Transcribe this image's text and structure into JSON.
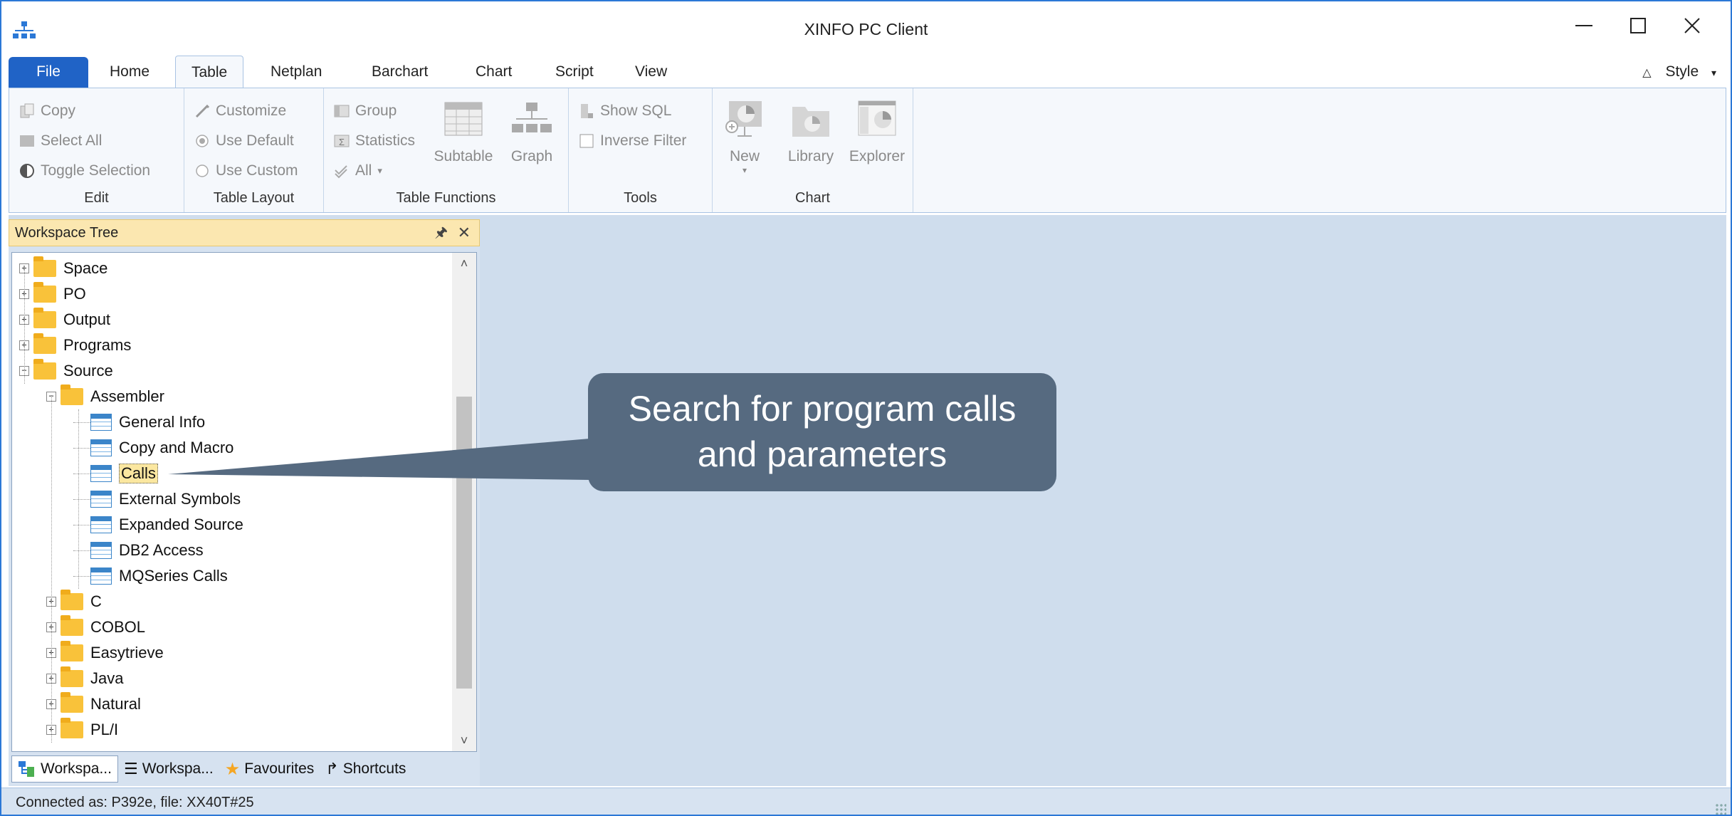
{
  "window": {
    "title": "XINFO PC Client",
    "accent_color": "#2b78d6"
  },
  "ribbon_tabs": [
    "File",
    "Home",
    "Table",
    "Netplan",
    "Barchart",
    "Chart",
    "Script",
    "View"
  ],
  "active_tab": "Table",
  "style_label": "Style",
  "ribbon": {
    "edit": {
      "label": "Edit",
      "copy": "Copy",
      "select_all": "Select All",
      "toggle_selection": "Toggle Selection"
    },
    "table_layout": {
      "label": "Table Layout",
      "customize": "Customize",
      "use_default": "Use Default",
      "use_custom": "Use Custom"
    },
    "table_functions": {
      "label": "Table Functions",
      "group": "Group",
      "statistics": "Statistics",
      "all": "All",
      "subtable": "Subtable",
      "graph": "Graph"
    },
    "tools": {
      "label": "Tools",
      "show_sql": "Show SQL",
      "inverse_filter": "Inverse Filter"
    },
    "chart": {
      "label": "Chart",
      "new": "New",
      "library": "Library",
      "explorer": "Explorer"
    }
  },
  "panel": {
    "title": "Workspace Tree",
    "tree": [
      {
        "label": "Space",
        "kind": "folder",
        "level": 0,
        "expander": "+"
      },
      {
        "label": "PO",
        "kind": "folder",
        "level": 0,
        "expander": "+"
      },
      {
        "label": "Output",
        "kind": "folder",
        "level": 0,
        "expander": "+"
      },
      {
        "label": "Programs",
        "kind": "folder",
        "level": 0,
        "expander": "+"
      },
      {
        "label": "Source",
        "kind": "folder",
        "level": 0,
        "expander": "-"
      },
      {
        "label": "Assembler",
        "kind": "folder",
        "level": 1,
        "expander": "-"
      },
      {
        "label": "General Info",
        "kind": "table",
        "level": 2
      },
      {
        "label": "Copy and Macro",
        "kind": "table",
        "level": 2
      },
      {
        "label": "Calls",
        "kind": "table",
        "level": 2,
        "selected": true
      },
      {
        "label": "External Symbols",
        "kind": "table",
        "level": 2
      },
      {
        "label": "Expanded Source",
        "kind": "table",
        "level": 2
      },
      {
        "label": "DB2 Access",
        "kind": "table",
        "level": 2
      },
      {
        "label": "MQSeries Calls",
        "kind": "table",
        "level": 2
      },
      {
        "label": "C",
        "kind": "folder",
        "level": 1,
        "expander": "+"
      },
      {
        "label": "COBOL",
        "kind": "folder",
        "level": 1,
        "expander": "+"
      },
      {
        "label": "Easytrieve",
        "kind": "folder",
        "level": 1,
        "expander": "+"
      },
      {
        "label": "Java",
        "kind": "folder",
        "level": 1,
        "expander": "+"
      },
      {
        "label": "Natural",
        "kind": "folder",
        "level": 1,
        "expander": "+"
      },
      {
        "label": "PL/I",
        "kind": "folder",
        "level": 1,
        "expander": "+"
      }
    ],
    "bottom_tabs": [
      "Workspa...",
      "Workspa...",
      "Favourites",
      "Shortcuts"
    ]
  },
  "status": "Connected as: P392e, file: XX40T#25",
  "callout": {
    "line1": "Search for program calls",
    "line2": "and parameters"
  }
}
